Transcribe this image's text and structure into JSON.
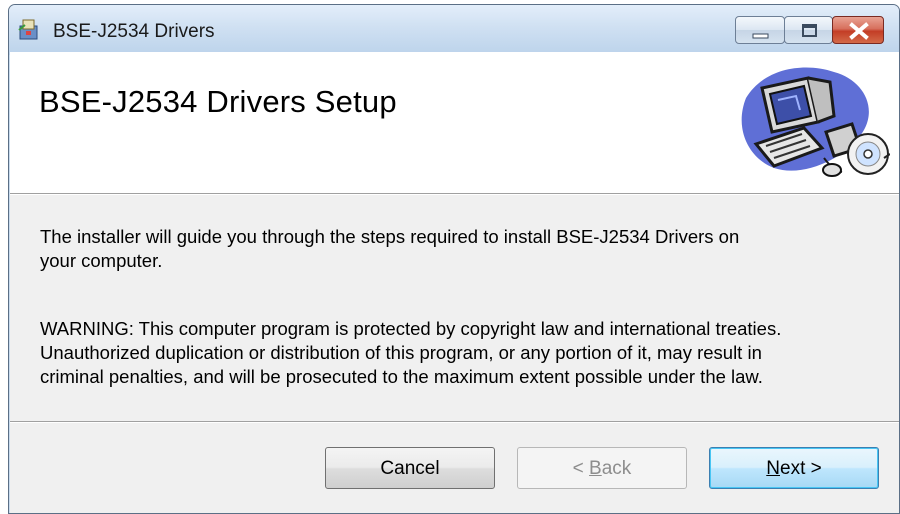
{
  "window": {
    "title": "BSE-J2534 Drivers",
    "caption_buttons": [
      "minimize",
      "maximize",
      "close"
    ]
  },
  "banner": {
    "title": "BSE-J2534 Drivers Setup",
    "image_icon": "computer-disc-icon"
  },
  "body": {
    "intro_line1": "The installer will guide you through the steps required to install BSE-J2534 Drivers on",
    "intro_line2": "your computer.",
    "warning_line1": "WARNING: This computer program is protected by copyright law and international treaties.",
    "warning_line2": "Unauthorized duplication or distribution of this program, or any portion of it, may result in",
    "warning_line3": "criminal penalties, and will be prosecuted to the maximum extent possible under the law."
  },
  "buttons": {
    "cancel_label": "Cancel",
    "back_prefix": "< ",
    "back_mnemonic": "B",
    "back_rest": "ack",
    "next_mnemonic": "N",
    "next_rest": "ext >"
  },
  "colors": {
    "titlebar": "#cfe0f2",
    "close_button": "#c33d26",
    "body_background": "#f0f0f0",
    "next_button_border": "#3c7fb1"
  }
}
